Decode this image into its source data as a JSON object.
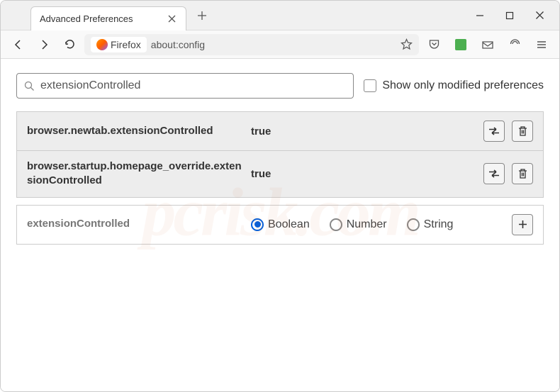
{
  "tab": {
    "title": "Advanced Preferences"
  },
  "urlbar": {
    "brand": "Firefox",
    "url": "about:config"
  },
  "search": {
    "value": "extensionControlled",
    "checkbox_label": "Show only modified preferences"
  },
  "prefs": [
    {
      "name": "browser.newtab.extensionControlled",
      "value": "true"
    },
    {
      "name": "browser.startup.homepage_override.extensionControlled",
      "value": "true"
    }
  ],
  "newpref": {
    "name": "extensionControlled",
    "types": [
      "Boolean",
      "Number",
      "String"
    ],
    "selected": "Boolean"
  },
  "watermark": "pcrisk.com"
}
